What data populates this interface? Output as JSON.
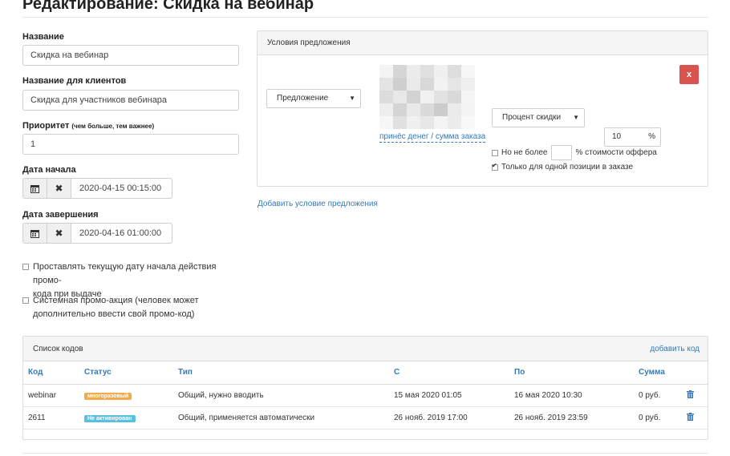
{
  "page_title": "Редактирование: Скидка на вебинар",
  "form": {
    "name_label": "Название",
    "name_value": "Скидка на вебинар",
    "client_name_label": "Название для клиентов",
    "client_name_value": "Скидка для участников вебинара",
    "priority_label": "Приоритет",
    "priority_hint": "(чем больше, тем важнее)",
    "priority_value": "1",
    "start_date_label": "Дата начала",
    "start_date_value": "2020-04-15 00:15:00",
    "end_date_label": "Дата завершения",
    "end_date_value": "2020-04-16 01:00:00",
    "checkbox_current_date_line1": "Проставлять текущую дату начала действия промо-",
    "checkbox_current_date_line2": "кода при выдаче",
    "checkbox_system_line1": "Системная промо-акция (человек может",
    "checkbox_system_line2": "дополнительно ввести свой промо-код)",
    "calendar_icon": "calendar-icon",
    "clear_icon": "times-icon"
  },
  "offer_conditions": {
    "title": "Условия предложения",
    "offer_select": "Предложение",
    "discount_type_select": "Процент скидки",
    "discount_value": "10",
    "discount_unit": "%",
    "delete_label": "x",
    "image_caption": "принёс денег / сумма заказа",
    "max_label": "Но не более",
    "max_value": "",
    "max_suffix": "% стоимости оффера",
    "single_position_label": "Только для одной позиции в заказе",
    "single_position_checked": true,
    "add_condition_link": "Добавить условие предложения"
  },
  "codes": {
    "title": "Список кодов",
    "add_link": "добавить код",
    "columns": [
      "Код",
      "Статус",
      "Тип",
      "С",
      "По",
      "Сумма"
    ],
    "rows": [
      {
        "code": "webinar",
        "status": "многоразовый",
        "status_color": "#f0ad4e",
        "type": "Общий, нужно вводить",
        "from": "15 мая 2020 01:05",
        "to": "16 мая 2020 10:30",
        "sum": "0 руб."
      },
      {
        "code": "2611",
        "status": "Не активирован",
        "status_color": "#5bc0de",
        "type": "Общий, применяется автоматически",
        "from": "26 нояб. 2019 17:00",
        "to": "26 нояб. 2019 23:59",
        "sum": "0 руб."
      }
    ]
  },
  "colors": {
    "link": "#337ab7",
    "danger": "#d9534f",
    "warning": "#f0ad4e",
    "info": "#5bc0de"
  }
}
